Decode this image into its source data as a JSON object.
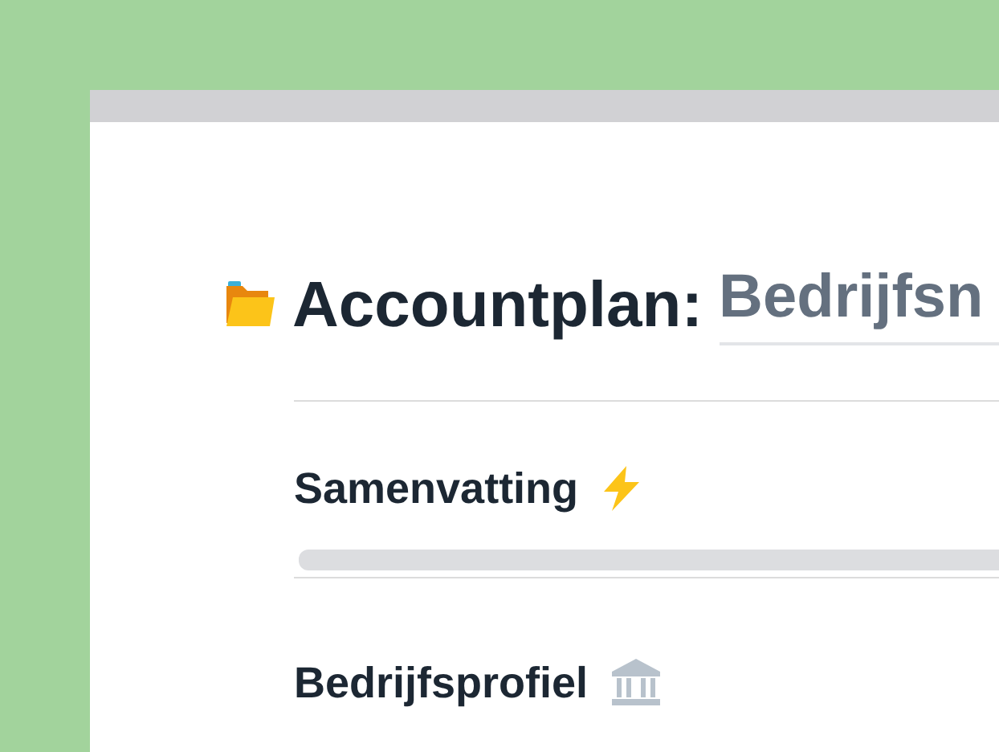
{
  "page": {
    "title_prefix": "Accountplan:",
    "title_field": {
      "value": "Bedrijfsn"
    }
  },
  "sections": [
    {
      "title": "Samenvatting",
      "kind": "skeleton"
    },
    {
      "title": "Bedrijfsprofiel",
      "kind": "plain"
    }
  ]
}
